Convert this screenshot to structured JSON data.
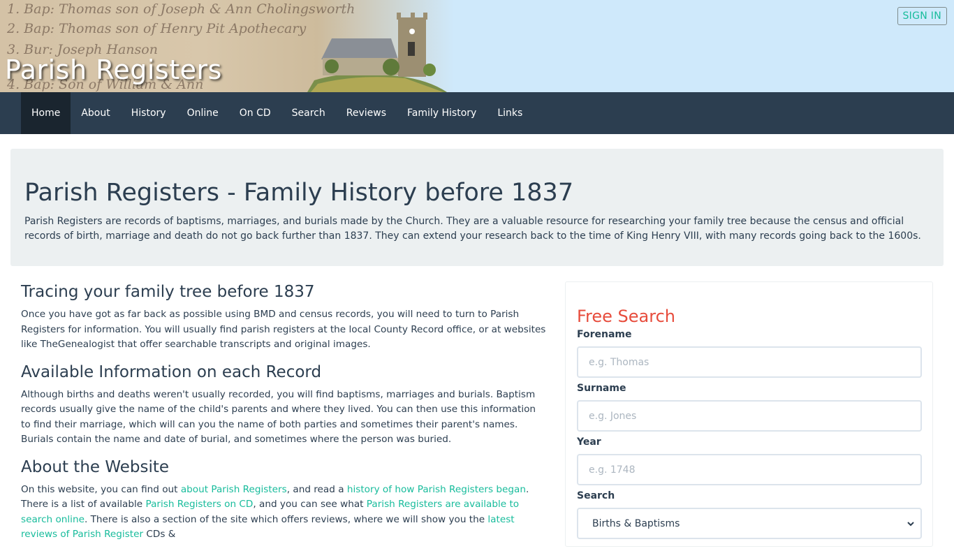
{
  "site": {
    "title": "Parish Registers",
    "signin_label": "SIGN IN"
  },
  "banner_script": [
    "1. Bap: Thomas son of Joseph & Ann Cholingsworth",
    "2. Bap: Thomas son of Henry Pit Apothecary",
    "3. Bur: Joseph Hanson",
    "4. Bap: Son of William & Ann"
  ],
  "nav": {
    "items": [
      {
        "label": "Home",
        "active": true
      },
      {
        "label": "About"
      },
      {
        "label": "History"
      },
      {
        "label": "Online"
      },
      {
        "label": "On CD"
      },
      {
        "label": "Search"
      },
      {
        "label": "Reviews"
      },
      {
        "label": "Family History"
      },
      {
        "label": "Links"
      }
    ]
  },
  "jumbotron": {
    "heading": "Parish Registers - Family History before 1837",
    "text": "Parish Registers are records of baptisms, marriages, and burials made by the Church. They are a valuable resource for researching your family tree because the census and official records of birth, marriage and death do not go back further than 1837. They can extend your research back to the time of King Henry VIII, with many records going back to the 1600s."
  },
  "sections": {
    "tracing": {
      "heading": "Tracing your family tree before 1837",
      "text": "Once you have got as far back as possible using BMD and census records, you will need to turn to Parish Registers for information. You will usually find parish registers at the local County Record office, or at websites like TheGenealogist that offer searchable transcripts and original images."
    },
    "available": {
      "heading": "Available Information on each Record",
      "text": "Although births and deaths weren't usually recorded, you will find baptisms, marriages and burials. Baptism records usually give the name of the child's parents and where they lived. You can then use this information to find their marriage, which will can you the name of both parties and sometimes their parent's names. Burials contain the name and date of burial, and sometimes where the person was buried."
    },
    "about": {
      "heading": "About the Website",
      "t1": "On this website, you can find out ",
      "link1": "about Parish Registers",
      "t2": ", and read a ",
      "link2": "history of how Parish Registers began",
      "t3": ". There is a list of available ",
      "link3": "Parish Registers on CD",
      "t4": ", and you can see what ",
      "link4": "Parish Registers are available to search online",
      "t5": ". There is also a section of the site which offers reviews, where we will show you the ",
      "link5": "latest reviews of Parish Register",
      "t6": " CDs &"
    }
  },
  "search_panel": {
    "heading": "Free Search",
    "forename": {
      "label": "Forename",
      "placeholder": "e.g. Thomas"
    },
    "surname": {
      "label": "Surname",
      "placeholder": "e.g. Jones"
    },
    "year": {
      "label": "Year",
      "placeholder": "e.g. 1748"
    },
    "search": {
      "label": "Search",
      "selected": "Births & Baptisms"
    }
  },
  "colors": {
    "navy": "#2c3e50",
    "accent": "#18bc9c",
    "red": "#e74c3c"
  }
}
